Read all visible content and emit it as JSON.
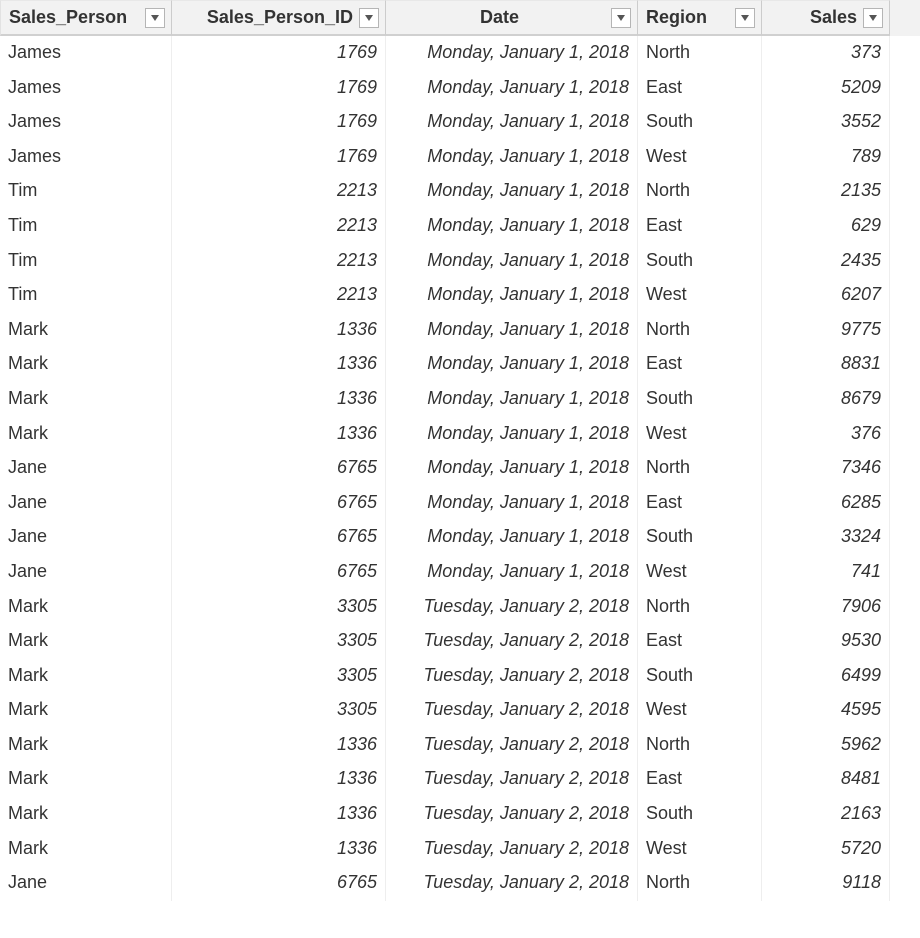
{
  "columns": [
    {
      "key": "person",
      "label": "Sales_Person",
      "cls": "col-person"
    },
    {
      "key": "id",
      "label": "Sales_Person_ID",
      "cls": "col-id"
    },
    {
      "key": "date",
      "label": "Date",
      "cls": "col-date"
    },
    {
      "key": "region",
      "label": "Region",
      "cls": "col-region"
    },
    {
      "key": "sales",
      "label": "Sales",
      "cls": "col-sales"
    }
  ],
  "rows": [
    {
      "person": "James",
      "id": "1769",
      "date": "Monday, January 1, 2018",
      "region": "North",
      "sales": "373"
    },
    {
      "person": "James",
      "id": "1769",
      "date": "Monday, January 1, 2018",
      "region": "East",
      "sales": "5209"
    },
    {
      "person": "James",
      "id": "1769",
      "date": "Monday, January 1, 2018",
      "region": "South",
      "sales": "3552"
    },
    {
      "person": "James",
      "id": "1769",
      "date": "Monday, January 1, 2018",
      "region": "West",
      "sales": "789"
    },
    {
      "person": "Tim",
      "id": "2213",
      "date": "Monday, January 1, 2018",
      "region": "North",
      "sales": "2135"
    },
    {
      "person": "Tim",
      "id": "2213",
      "date": "Monday, January 1, 2018",
      "region": "East",
      "sales": "629"
    },
    {
      "person": "Tim",
      "id": "2213",
      "date": "Monday, January 1, 2018",
      "region": "South",
      "sales": "2435"
    },
    {
      "person": "Tim",
      "id": "2213",
      "date": "Monday, January 1, 2018",
      "region": "West",
      "sales": "6207"
    },
    {
      "person": "Mark",
      "id": "1336",
      "date": "Monday, January 1, 2018",
      "region": "North",
      "sales": "9775"
    },
    {
      "person": "Mark",
      "id": "1336",
      "date": "Monday, January 1, 2018",
      "region": "East",
      "sales": "8831"
    },
    {
      "person": "Mark",
      "id": "1336",
      "date": "Monday, January 1, 2018",
      "region": "South",
      "sales": "8679"
    },
    {
      "person": "Mark",
      "id": "1336",
      "date": "Monday, January 1, 2018",
      "region": "West",
      "sales": "376"
    },
    {
      "person": "Jane",
      "id": "6765",
      "date": "Monday, January 1, 2018",
      "region": "North",
      "sales": "7346"
    },
    {
      "person": "Jane",
      "id": "6765",
      "date": "Monday, January 1, 2018",
      "region": "East",
      "sales": "6285"
    },
    {
      "person": "Jane",
      "id": "6765",
      "date": "Monday, January 1, 2018",
      "region": "South",
      "sales": "3324"
    },
    {
      "person": "Jane",
      "id": "6765",
      "date": "Monday, January 1, 2018",
      "region": "West",
      "sales": "741"
    },
    {
      "person": "Mark",
      "id": "3305",
      "date": "Tuesday, January 2, 2018",
      "region": "North",
      "sales": "7906"
    },
    {
      "person": "Mark",
      "id": "3305",
      "date": "Tuesday, January 2, 2018",
      "region": "East",
      "sales": "9530"
    },
    {
      "person": "Mark",
      "id": "3305",
      "date": "Tuesday, January 2, 2018",
      "region": "South",
      "sales": "6499"
    },
    {
      "person": "Mark",
      "id": "3305",
      "date": "Tuesday, January 2, 2018",
      "region": "West",
      "sales": "4595"
    },
    {
      "person": "Mark",
      "id": "1336",
      "date": "Tuesday, January 2, 2018",
      "region": "North",
      "sales": "5962"
    },
    {
      "person": "Mark",
      "id": "1336",
      "date": "Tuesday, January 2, 2018",
      "region": "East",
      "sales": "8481"
    },
    {
      "person": "Mark",
      "id": "1336",
      "date": "Tuesday, January 2, 2018",
      "region": "South",
      "sales": "2163"
    },
    {
      "person": "Mark",
      "id": "1336",
      "date": "Tuesday, January 2, 2018",
      "region": "West",
      "sales": "5720"
    },
    {
      "person": "Jane",
      "id": "6765",
      "date": "Tuesday, January 2, 2018",
      "region": "North",
      "sales": "9118"
    }
  ]
}
